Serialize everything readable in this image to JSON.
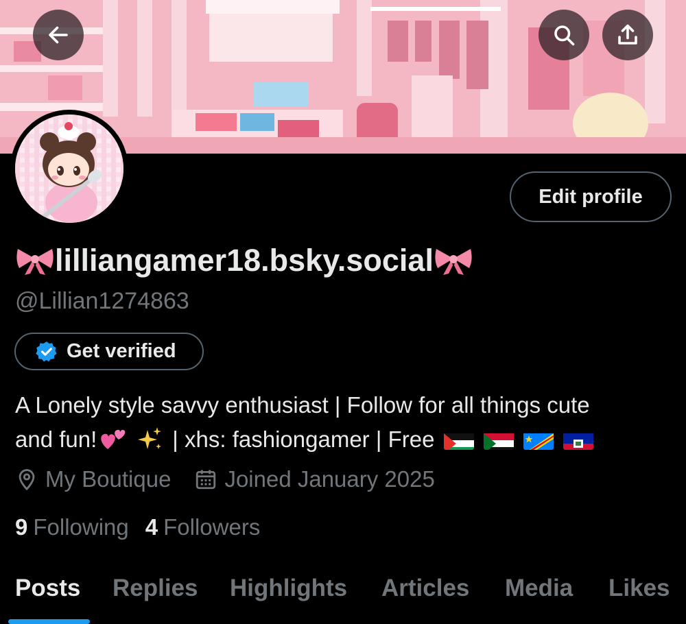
{
  "header": {
    "banner_description_colors": {
      "light": "#f7c6cf",
      "dark": "#e27f95"
    },
    "icons": {
      "back": "arrow-left-icon",
      "search": "search-icon",
      "share": "share-icon"
    }
  },
  "profile": {
    "display_name": "lilliangamer18.bsky.social",
    "handle": "@Lillian1274863",
    "edit_button": "Edit profile",
    "verify_button": "Get verified",
    "bio_line1": "A Lonely style savvy enthusiast | Follow for all things cute",
    "bio_line2_a": "and fun!",
    "bio_line2_b": "| xhs: fashiongamer | Free",
    "location": "My Boutique",
    "joined": "Joined January 2025",
    "following_count": "9",
    "following_label": "Following",
    "followers_count": "4",
    "followers_label": "Followers"
  },
  "tabs": [
    "Posts",
    "Replies",
    "Highlights",
    "Articles",
    "Media",
    "Likes"
  ],
  "colors": {
    "accent": "#1d9bf0",
    "muted": "#71767b",
    "text": "#e7e9ea"
  }
}
